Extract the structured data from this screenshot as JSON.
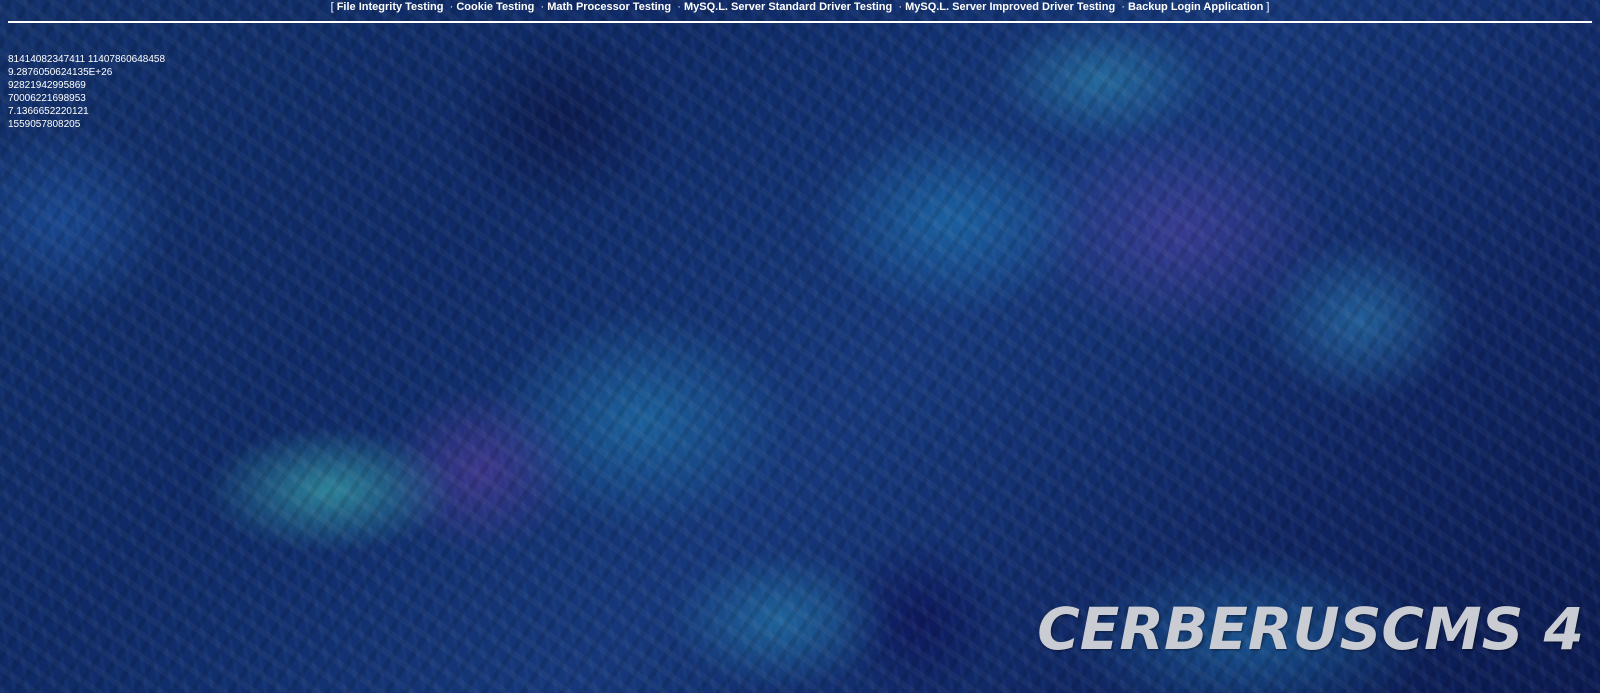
{
  "nav": {
    "open_bracket": "[",
    "close_bracket": "]",
    "separator": "·",
    "links": [
      "File Integrity Testing",
      "Cookie Testing",
      "Math Processor Testing",
      "MySQ.L. Server Standard Driver Testing",
      "MySQ.L. Server Improved Driver Testing",
      "Backup Login Application"
    ]
  },
  "stats": {
    "lines": [
      "81414082347411 11407860648458",
      "9.2876050624135E+26",
      "92821942995869",
      "70006221698953",
      "7.1366652220121",
      "1559057808205"
    ]
  },
  "logo": {
    "text": "CERBERUSCMS 4"
  },
  "colors": {
    "text": "#ffffff",
    "logo": "#c9ccd3",
    "background": "#12306a"
  }
}
